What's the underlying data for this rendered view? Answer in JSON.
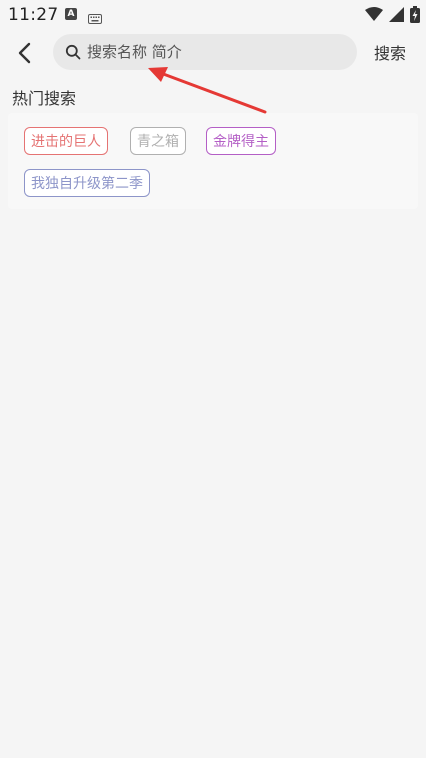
{
  "status_bar": {
    "time": "11:27",
    "notification_icons": [
      "a-app-icon",
      "keyboard-icon"
    ],
    "system_icons": [
      "wifi-icon",
      "signal-icon",
      "battery-charging-icon"
    ]
  },
  "header": {
    "back_icon": "chevron-left-icon",
    "search_placeholder": "搜索名称 简介",
    "search_value": "",
    "search_button_label": "搜索"
  },
  "hot_search": {
    "title": "热门搜索",
    "tags": [
      {
        "label": "进击的巨人",
        "color": "#e57373"
      },
      {
        "label": "青之箱",
        "color": "#b0b0b0"
      },
      {
        "label": "金牌得主",
        "color": "#b45fc6"
      },
      {
        "label": "我独自升级第二季",
        "color": "#8d95c9"
      }
    ]
  },
  "annotation": {
    "type": "red-arrow",
    "color": "#e53935"
  }
}
